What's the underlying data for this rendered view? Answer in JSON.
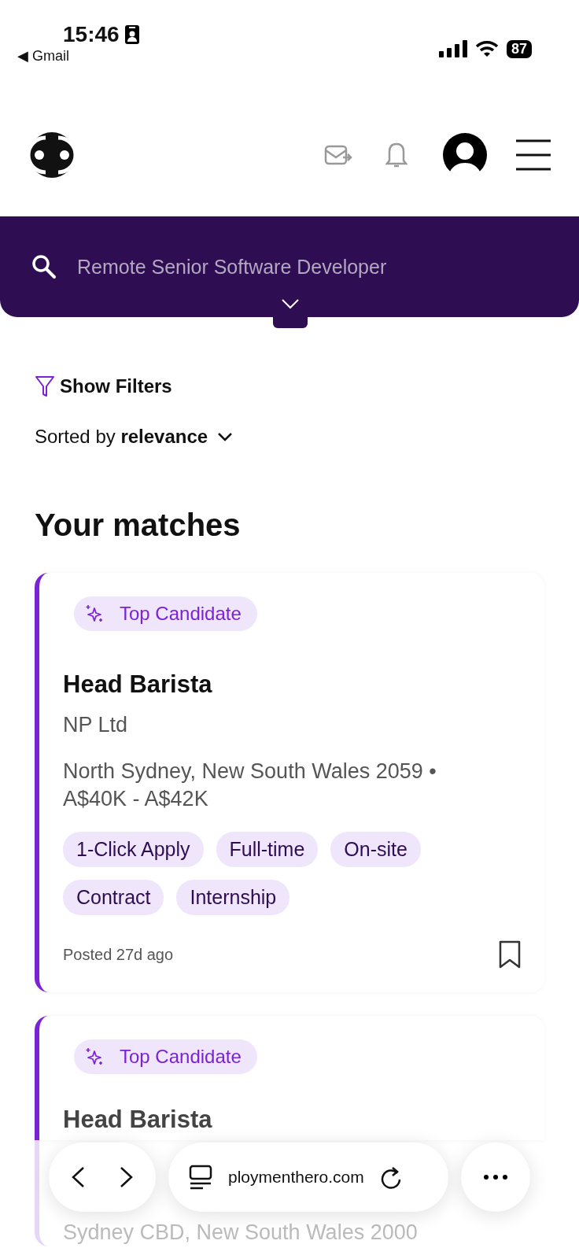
{
  "status_bar": {
    "time": "15:46",
    "back_app": "◀ Gmail",
    "battery": "87"
  },
  "search": {
    "value": "Remote Senior Software Developer"
  },
  "filters": {
    "label": "Show Filters"
  },
  "sort": {
    "text": "Sorted by **relevance**"
  },
  "section_title": "Your matches",
  "jobs": [
    {
      "badge": "Top Candidate",
      "title": "Head Barista",
      "company": "NP Ltd",
      "location": "North Sydney, New South Wales 2059 •",
      "salary": "A$40K - A$42K",
      "tags": [
        "1-Click Apply",
        "Full-time",
        "On-site",
        "Contract",
        "Internship"
      ],
      "posted": "Posted 27d ago",
      "saved": false
    },
    {
      "badge": "Top Candidate",
      "title": "Head Barista",
      "location": "Sydney CBD, New South Wales 2000"
    }
  ],
  "browser_bar": {
    "url": "ploymenthero.com"
  }
}
